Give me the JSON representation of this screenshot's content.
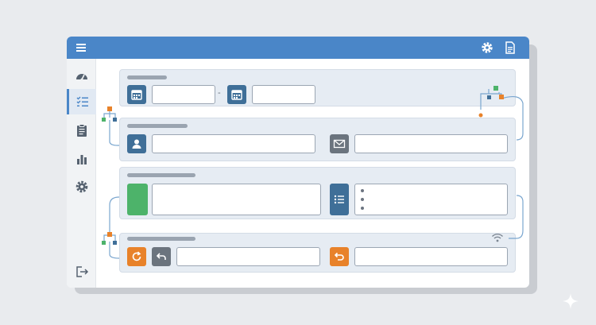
{
  "app": {
    "brand_color": "#4a86c8",
    "accent_orange": "#e8822a",
    "accent_green": "#4db36a",
    "tile_blue": "#3f6f98",
    "tile_gray": "#6b747e"
  },
  "topbar": {
    "menu_icon": "hamburger-menu-icon",
    "settings_icon": "gear-icon",
    "document_icon": "document-icon"
  },
  "sidebar": {
    "items": [
      {
        "icon": "dashboard-gauge-icon",
        "active": false
      },
      {
        "icon": "checklist-icon",
        "active": true
      },
      {
        "icon": "clipboard-icon",
        "active": false
      },
      {
        "icon": "bar-chart-icon",
        "active": false
      },
      {
        "icon": "gear-icon",
        "active": false
      }
    ],
    "logout_icon": "logout-icon"
  },
  "form": {
    "date_range": {
      "start_value": "",
      "end_value": "",
      "separator": "-"
    },
    "contact": {
      "name_value": "",
      "email_value": ""
    },
    "details": {
      "color_value": "",
      "list_value": ""
    },
    "actions": {
      "retry_value": "",
      "undo_value": ""
    }
  },
  "status": {
    "wifi_icon": "wifi-icon",
    "watermark_icon": "sparkle-icon"
  }
}
